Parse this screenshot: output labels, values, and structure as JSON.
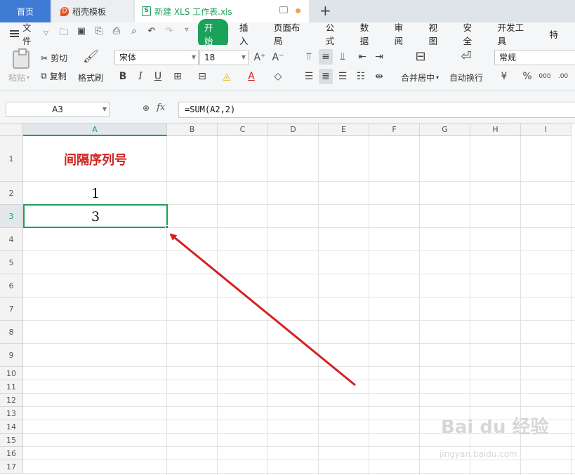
{
  "tabs": {
    "home": "首页",
    "template": "稻壳模板",
    "document": "新建 XLS 工作表.xls",
    "new_tab": "+"
  },
  "menu": {
    "file": "文件",
    "items": [
      "开始",
      "插入",
      "页面布局",
      "公式",
      "数据",
      "审阅",
      "视图",
      "安全",
      "开发工具",
      "特"
    ]
  },
  "ribbon": {
    "paste": "粘贴",
    "cut": "剪切",
    "copy": "复制",
    "format_painter": "格式刷",
    "font_name": "宋体",
    "font_size": "18",
    "merge_center": "合并居中",
    "wrap_text": "自动换行",
    "number_format": "常规"
  },
  "formula_bar": {
    "name_box": "A3",
    "fx": "fx",
    "formula": "=SUM(A2,2)"
  },
  "sheet": {
    "columns": [
      "A",
      "B",
      "C",
      "D",
      "E",
      "F",
      "G",
      "H",
      "I"
    ],
    "rows": [
      "1",
      "2",
      "3",
      "4",
      "5",
      "6",
      "7",
      "8",
      "9",
      "10",
      "11",
      "12",
      "13",
      "14",
      "15",
      "16",
      "17"
    ],
    "cells": {
      "A1": "间隔序列号",
      "A2": "1",
      "A3": "3"
    },
    "selected_cell": "A3"
  },
  "annotation": {
    "arrow_color": "#d62020"
  },
  "watermark": {
    "brand": "Bai du 经验",
    "url": "jingyan.baidu.com"
  },
  "colors": {
    "accent": "#1aa25b",
    "tab_home": "#3d7bd5",
    "title_text": "#d0231f"
  }
}
